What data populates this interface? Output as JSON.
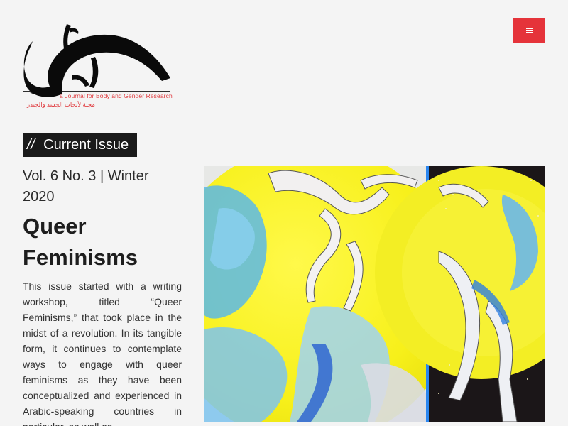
{
  "logo": {
    "subtitle": "a Journal for Body and Gender Research",
    "arabic_subtitle": "مجلة لأبحاث الجسد والجندر",
    "icon": "kohl-logo"
  },
  "header": {
    "menu_icon": "hamburger-icon"
  },
  "section": {
    "slashes": "//",
    "label": "Current Issue"
  },
  "issue": {
    "meta": "Vol. 6 No. 3 | Winter 2020",
    "title": "Queer Feminisms",
    "description": "This issue started with a writing workshop, titled “Queer Feminisms,” that took place in the midst of a revolution. In its tangible form, it continues to contemplate ways to engage with queer feminisms as they have been conceptualized and experienced in Arabic-speaking countries in particular, as well as",
    "cover_alt": "Cover artwork"
  },
  "colors": {
    "accent": "#e5333a",
    "label_bg": "#1a1a1a",
    "background": "#f4f4f4"
  }
}
